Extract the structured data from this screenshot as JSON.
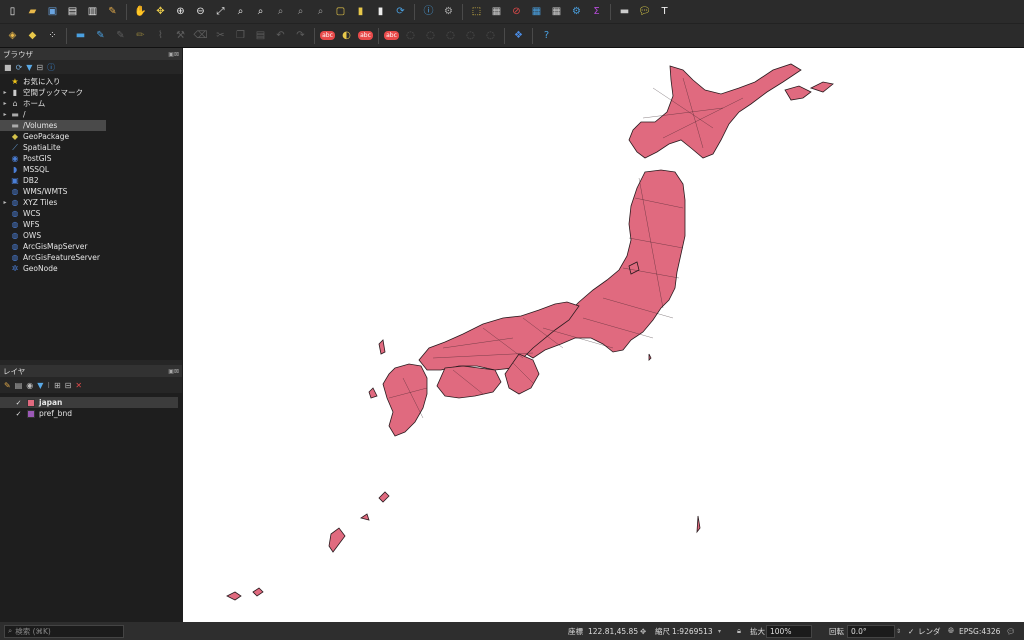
{
  "toolbar1": {
    "icons": [
      "new-project-icon",
      "open-project-icon",
      "save-project-icon",
      "new-print-layout-icon",
      "layout-manager-icon",
      "style-manager-icon",
      "pan-icon",
      "pan-to-selection-icon",
      "zoom-in-icon",
      "zoom-out-icon",
      "zoom-full-icon",
      "zoom-to-selection-icon",
      "zoom-to-layer-icon",
      "zoom-native-icon",
      "zoom-last-icon",
      "zoom-next-icon",
      "new-map-view-icon",
      "new-bookmark-icon",
      "show-bookmarks-icon",
      "refresh-icon",
      "identify-icon",
      "measure-icon",
      "select-features-icon",
      "attribute-table-icon",
      "deselect-icon",
      "open-attribute-table-icon",
      "field-calculator-icon",
      "processing-toolbox-icon",
      "statistical-summary-icon",
      "measure-line-icon",
      "map-tips-icon",
      "text-annotation-icon"
    ]
  },
  "toolbar2": {
    "icons": [
      "data-source-manager-icon",
      "add-layer-icon",
      "digitize-icon",
      "current-edits-icon",
      "toggle-editing-icon",
      "save-edits-icon",
      "add-feature-icon",
      "vertex-tool-icon",
      "node-tool-icon",
      "delete-selected-icon",
      "cut-features-icon",
      "copy-features-icon",
      "paste-features-icon",
      "undo-icon",
      "redo-icon",
      "label-abc-icon",
      "layer-labeling-icon",
      "pin-labels-icon",
      "diagram-icon",
      "highlight-labels-icon",
      "move-label-icon",
      "rotate-label-icon",
      "change-label-icon",
      "label-rule-icon",
      "python-console-icon",
      "help-icon"
    ]
  },
  "browser": {
    "title": "ブラウザ",
    "items": [
      {
        "label": "お気に入り",
        "icon": "star-icon",
        "arrow": false
      },
      {
        "label": "空間ブックマーク",
        "icon": "bookmark-icon",
        "arrow": true
      },
      {
        "label": "ホーム",
        "icon": "home-folder-icon",
        "arrow": true
      },
      {
        "label": "/",
        "icon": "folder-icon",
        "arrow": true
      },
      {
        "label": "/Volumes",
        "icon": "folder-icon",
        "arrow": false,
        "selected": true
      },
      {
        "label": "GeoPackage",
        "icon": "geopackage-icon",
        "arrow": false
      },
      {
        "label": "SpatiaLite",
        "icon": "spatialite-icon",
        "arrow": false
      },
      {
        "label": "PostGIS",
        "icon": "postgis-icon",
        "arrow": false
      },
      {
        "label": "MSSQL",
        "icon": "mssql-icon",
        "arrow": false
      },
      {
        "label": "DB2",
        "icon": "db2-icon",
        "arrow": false
      },
      {
        "label": "WMS/WMTS",
        "icon": "wms-icon",
        "arrow": false
      },
      {
        "label": "XYZ Tiles",
        "icon": "xyz-tiles-icon",
        "arrow": true
      },
      {
        "label": "WCS",
        "icon": "wcs-icon",
        "arrow": false
      },
      {
        "label": "WFS",
        "icon": "wfs-icon",
        "arrow": false
      },
      {
        "label": "OWS",
        "icon": "ows-icon",
        "arrow": false
      },
      {
        "label": "ArcGisMapServer",
        "icon": "arcgis-map-icon",
        "arrow": false
      },
      {
        "label": "ArcGisFeatureServer",
        "icon": "arcgis-feature-icon",
        "arrow": false
      },
      {
        "label": "GeoNode",
        "icon": "geonode-icon",
        "arrow": false
      }
    ]
  },
  "layers": {
    "title": "レイヤ",
    "items": [
      {
        "label": "japan",
        "color": "#e06a7f",
        "checked": true,
        "selected": true
      },
      {
        "label": "pref_bnd",
        "color": "#9b59b6",
        "checked": true,
        "selected": false
      }
    ]
  },
  "status": {
    "search_placeholder": "検索 (⌘K)",
    "coord_label": "座標",
    "coord_value": "122.81,45.85",
    "scale_label": "縮尺",
    "scale_value": "1:9269513",
    "mag_label": "拡大",
    "mag_value": "100%",
    "rot_label": "回転",
    "rot_value": "0.0°",
    "render_label": "レンダ",
    "crs_label": "EPSG:4326"
  },
  "colors": {
    "map_fill": "#e06a7f",
    "map_stroke": "#2a1a1e"
  }
}
